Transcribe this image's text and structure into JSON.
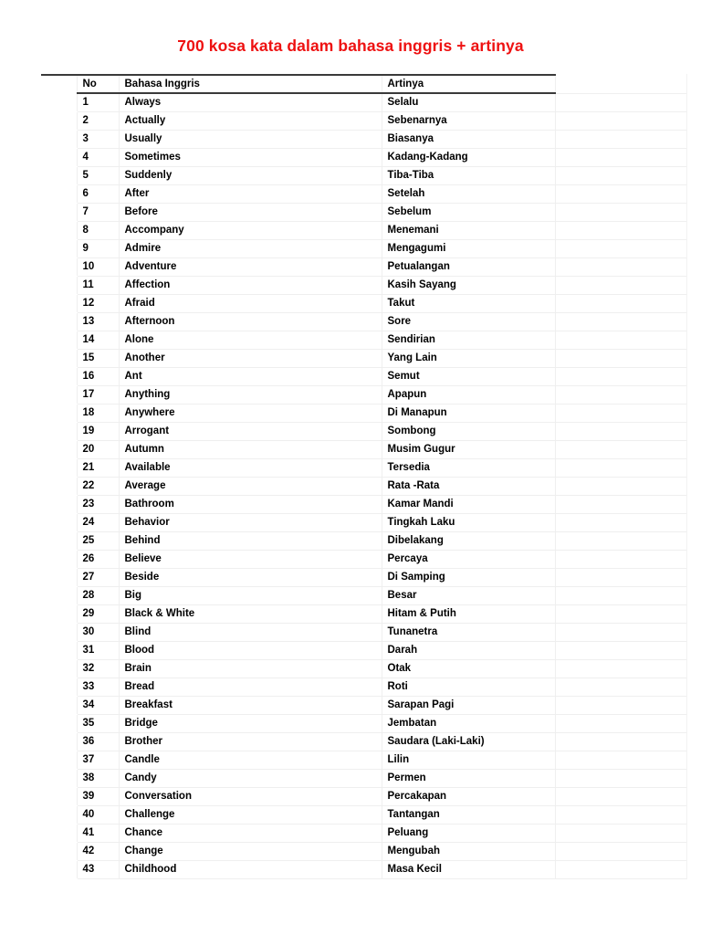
{
  "document": {
    "title": "700 kosa kata dalam bahasa inggris + artinya",
    "title_color": "#ee1111"
  },
  "table": {
    "headers": {
      "no": "No",
      "english": "Bahasa Inggris",
      "meaning": "Artinya",
      "spacer": "",
      "tail": ""
    },
    "rows": [
      {
        "no": "1",
        "english": "Always",
        "meaning": "Selalu"
      },
      {
        "no": "2",
        "english": "Actually",
        "meaning": "Sebenarnya"
      },
      {
        "no": "3",
        "english": "Usually",
        "meaning": "Biasanya"
      },
      {
        "no": "4",
        "english": "Sometimes",
        "meaning": "Kadang-Kadang"
      },
      {
        "no": "5",
        "english": "Suddenly",
        "meaning": "Tiba-Tiba"
      },
      {
        "no": "6",
        "english": "After",
        "meaning": "Setelah"
      },
      {
        "no": "7",
        "english": "Before",
        "meaning": "Sebelum"
      },
      {
        "no": "8",
        "english": "Accompany",
        "meaning": "Menemani"
      },
      {
        "no": "9",
        "english": "Admire",
        "meaning": "Mengagumi"
      },
      {
        "no": "10",
        "english": "Adventure",
        "meaning": "Petualangan"
      },
      {
        "no": "11",
        "english": "Affection",
        "meaning": "Kasih Sayang"
      },
      {
        "no": "12",
        "english": "Afraid",
        "meaning": "Takut"
      },
      {
        "no": "13",
        "english": "Afternoon",
        "meaning": "Sore"
      },
      {
        "no": "14",
        "english": "Alone",
        "meaning": "Sendirian"
      },
      {
        "no": "15",
        "english": "Another",
        "meaning": "Yang Lain"
      },
      {
        "no": "16",
        "english": "Ant",
        "meaning": "Semut"
      },
      {
        "no": "17",
        "english": "Anything",
        "meaning": "Apapun"
      },
      {
        "no": "18",
        "english": "Anywhere",
        "meaning": "Di Manapun"
      },
      {
        "no": "19",
        "english": "Arrogant",
        "meaning": "Sombong"
      },
      {
        "no": "20",
        "english": "Autumn",
        "meaning": "Musim Gugur"
      },
      {
        "no": "21",
        "english": "Available",
        "meaning": "Tersedia"
      },
      {
        "no": "22",
        "english": "Average",
        "meaning": "Rata -Rata"
      },
      {
        "no": "23",
        "english": "Bathroom",
        "meaning": "Kamar Mandi"
      },
      {
        "no": "24",
        "english": "Behavior",
        "meaning": "Tingkah Laku"
      },
      {
        "no": "25",
        "english": "Behind",
        "meaning": "Dibelakang"
      },
      {
        "no": "26",
        "english": "Believe",
        "meaning": "Percaya"
      },
      {
        "no": "27",
        "english": "Beside",
        "meaning": "Di Samping"
      },
      {
        "no": "28",
        "english": "Big",
        "meaning": "Besar"
      },
      {
        "no": "29",
        "english": "Black & White",
        "meaning": "Hitam & Putih"
      },
      {
        "no": "30",
        "english": "Blind",
        "meaning": "Tunanetra"
      },
      {
        "no": "31",
        "english": "Blood",
        "meaning": "Darah"
      },
      {
        "no": "32",
        "english": "Brain",
        "meaning": "Otak"
      },
      {
        "no": "33",
        "english": "Bread",
        "meaning": "Roti"
      },
      {
        "no": "34",
        "english": "Breakfast",
        "meaning": "Sarapan Pagi"
      },
      {
        "no": "35",
        "english": "Bridge",
        "meaning": "Jembatan"
      },
      {
        "no": "36",
        "english": "Brother",
        "meaning": "Saudara (Laki-Laki)"
      },
      {
        "no": "37",
        "english": "Candle",
        "meaning": "Lilin"
      },
      {
        "no": "38",
        "english": "Candy",
        "meaning": "Permen"
      },
      {
        "no": "39",
        "english": "Conversation",
        "meaning": "Percakapan"
      },
      {
        "no": "40",
        "english": "Challenge",
        "meaning": "Tantangan"
      },
      {
        "no": "41",
        "english": "Chance",
        "meaning": "Peluang"
      },
      {
        "no": "42",
        "english": "Change",
        "meaning": "Mengubah"
      },
      {
        "no": "43",
        "english": "Childhood",
        "meaning": "Masa Kecil"
      }
    ]
  }
}
